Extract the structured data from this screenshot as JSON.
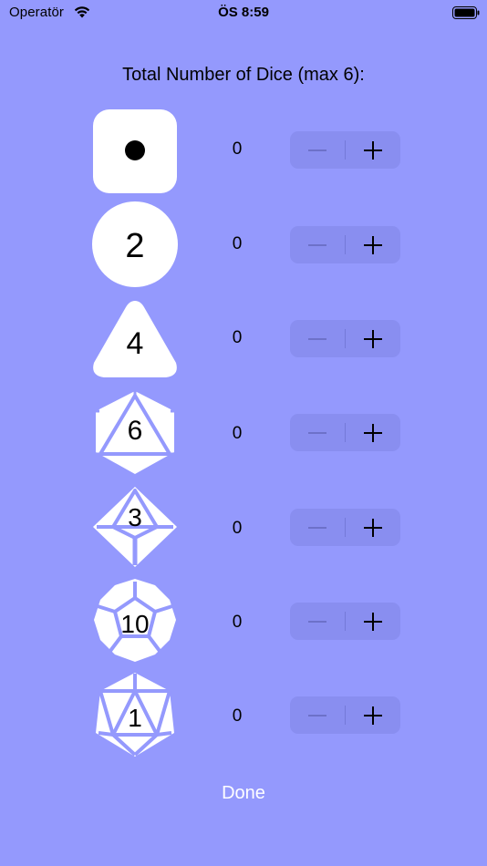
{
  "status_bar": {
    "carrier": "Operatör",
    "time": "ÖS 8:59"
  },
  "title": "Total Number of Dice (max 6):",
  "dice": [
    {
      "die_label": "",
      "count": "0",
      "icon": "d2-coin-icon"
    },
    {
      "die_label": "2",
      "count": "0",
      "icon": "d2-circle-icon"
    },
    {
      "die_label": "4",
      "count": "0",
      "icon": "d4-icon"
    },
    {
      "die_label": "6",
      "count": "0",
      "icon": "d6-icon"
    },
    {
      "die_label": "3",
      "count": "0",
      "icon": "d8-icon"
    },
    {
      "die_label": "10",
      "count": "0",
      "icon": "d10-icon"
    },
    {
      "die_label": "1",
      "count": "0",
      "icon": "d20-icon"
    }
  ],
  "done_label": "Done",
  "colors": {
    "background": "#9499fd",
    "stepper_bg": "#898ef0",
    "die_fill": "#ffffff"
  }
}
